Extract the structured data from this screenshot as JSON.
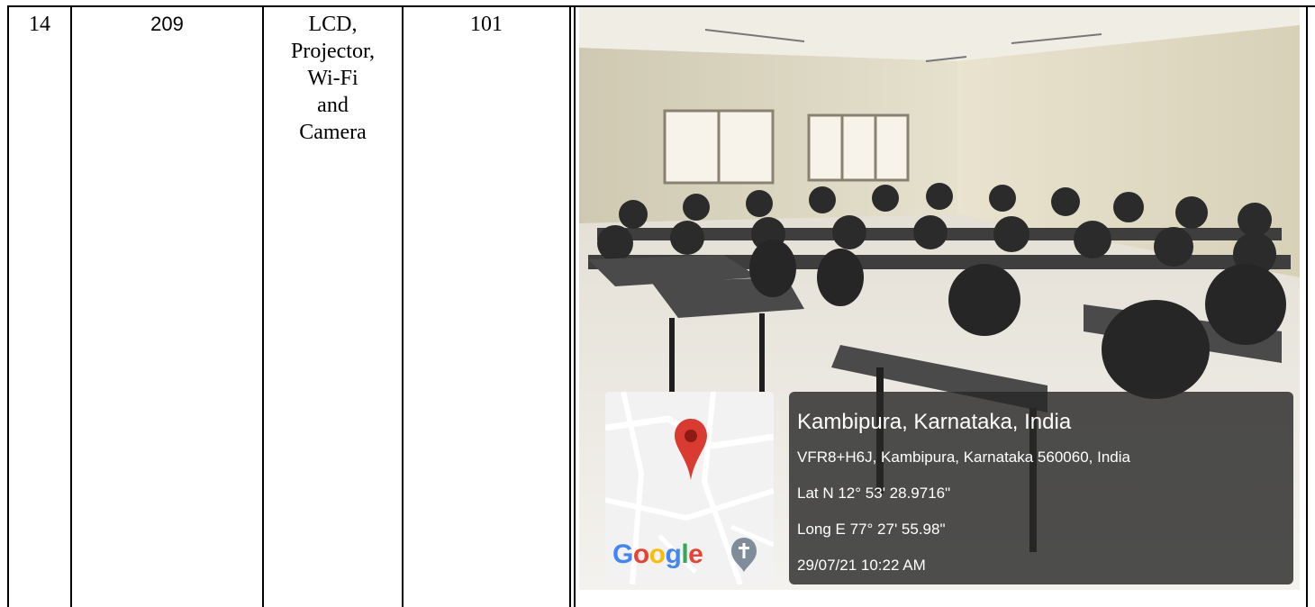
{
  "row": {
    "sl_no": "14",
    "room_no": "209",
    "facilities": [
      "LCD,",
      "Projector,",
      "Wi-Fi",
      "and",
      "Camera"
    ],
    "capacity": "101"
  },
  "photo": {
    "map_logo": [
      "G",
      "o",
      "o",
      "g",
      "l",
      "e"
    ],
    "map_pin_icon": "location-pin-icon",
    "map_church_icon": "church-cross-icon",
    "location_title": "Kambipura, Karnataka, India",
    "address": "VFR8+H6J, Kambipura, Karnataka 560060, India",
    "latitude": "Lat N 12° 53' 28.9716\"",
    "longitude": "Long E 77° 27' 55.98\"",
    "timestamp": "29/07/21 10:22 AM"
  },
  "colors": {
    "pin": "#D93B30",
    "card_bg": "#282828"
  }
}
